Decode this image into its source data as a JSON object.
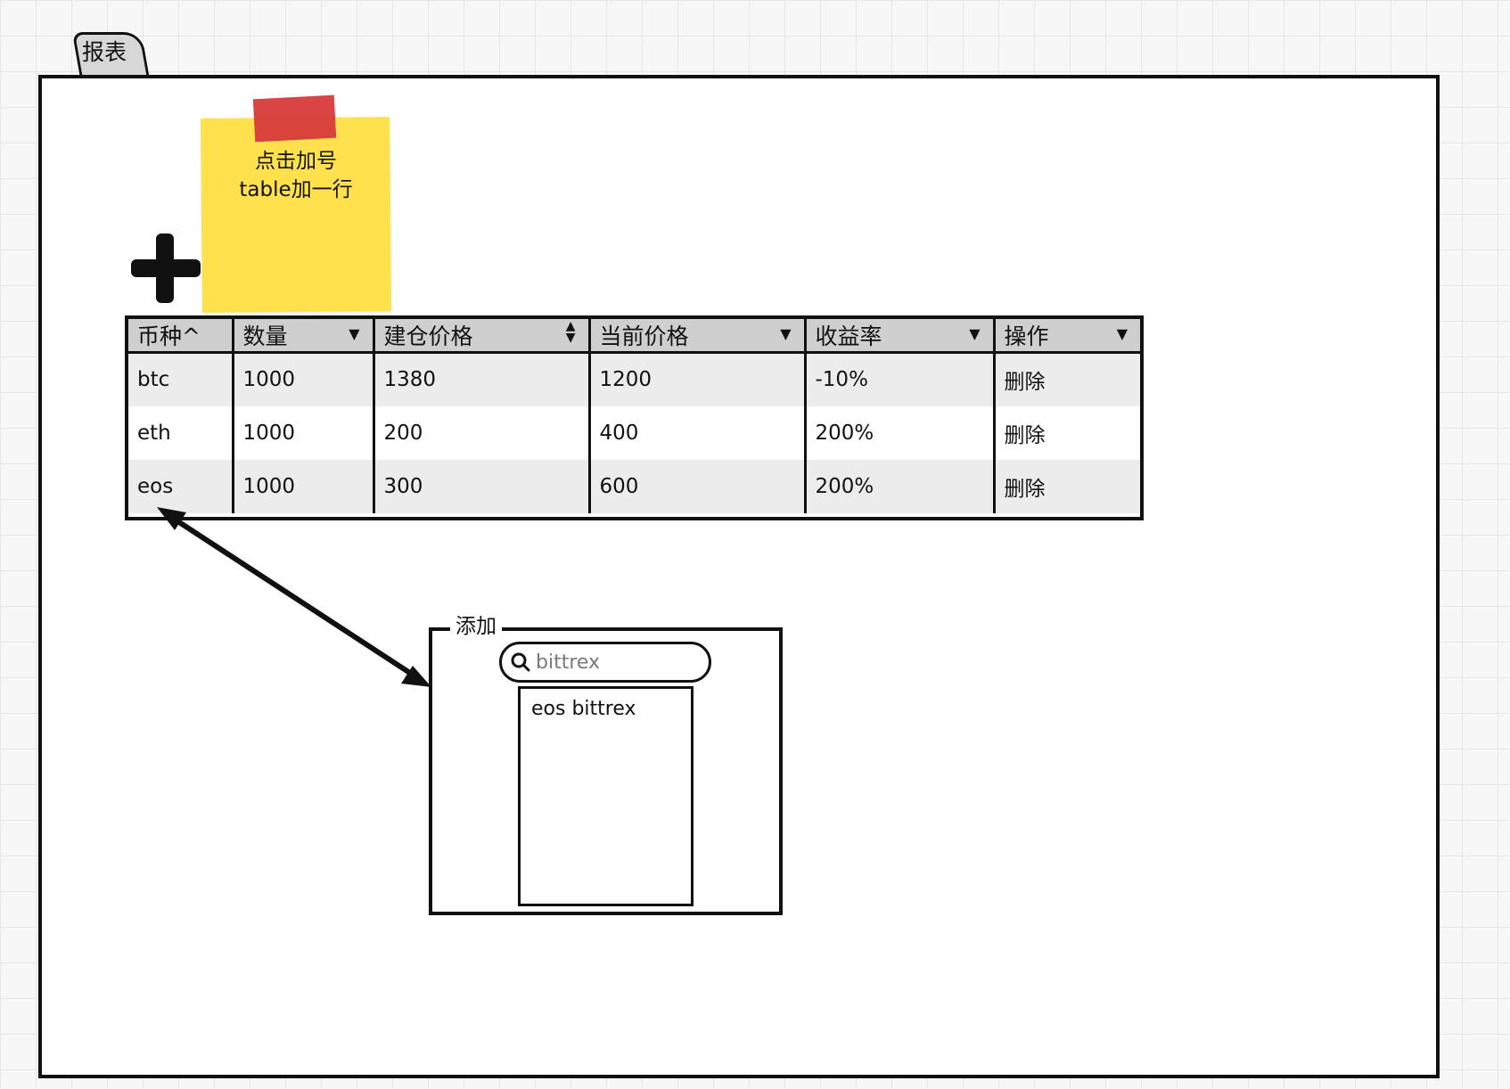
{
  "tab": {
    "label": "报表"
  },
  "sticky_note": {
    "lines": [
      "点击加号",
      "table加一行"
    ]
  },
  "icons": {
    "add": "plus-icon",
    "search": "search-icon",
    "sort_desc": "caret-down-icon",
    "sort_both": "sort-both-icon"
  },
  "table": {
    "headers": [
      "币种^",
      "数量",
      "建仓价格",
      "当前价格",
      "收益率",
      "操作"
    ],
    "rows": [
      [
        "btc",
        "1000",
        "1380",
        "1200",
        "-10%",
        "删除"
      ],
      [
        "eth",
        "1000",
        "200",
        "400",
        "200%",
        "删除"
      ],
      [
        "eos",
        "1000",
        "300",
        "600",
        "200%",
        "删除"
      ]
    ]
  },
  "add_panel": {
    "legend": "添加",
    "search_value": "",
    "search_placeholder": "bittrex",
    "results": [
      "eos bittrex"
    ]
  },
  "colors": {
    "sticky": "#ffe14d",
    "tape": "#d83a3a",
    "header_bg": "#cfcfcf",
    "row_stripe": "#ececec",
    "border": "#111111"
  }
}
